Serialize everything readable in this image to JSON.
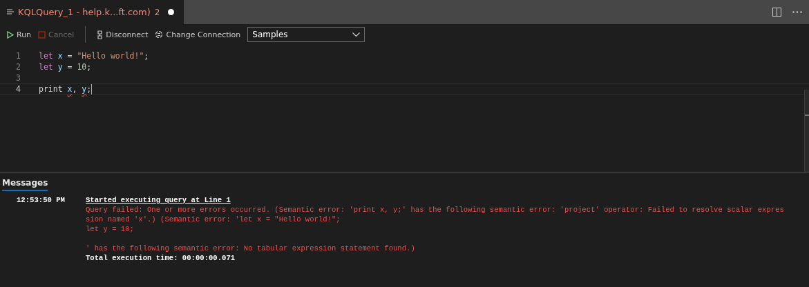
{
  "tab": {
    "title": "KQLQuery_1 - help.k...ft.com)",
    "problems": "2",
    "dirty": true
  },
  "toolbar": {
    "items": [
      {
        "kind": "run",
        "label": "Run",
        "disabled": false
      },
      {
        "kind": "cancel",
        "label": "Cancel",
        "disabled": true
      },
      {
        "kind": "disconnect",
        "label": "Disconnect",
        "disabled": false
      },
      {
        "kind": "connection",
        "label": "Change Connection",
        "disabled": false
      }
    ],
    "database": {
      "value": "Samples"
    }
  },
  "editor": {
    "lines": [
      {
        "number": "1",
        "current": false,
        "tokens": [
          {
            "kind": "keyword",
            "text": "let"
          },
          {
            "kind": "ident",
            "text": " x "
          },
          {
            "kind": "plain",
            "text": "= "
          },
          {
            "kind": "string",
            "text": "\"Hello world!\""
          },
          {
            "kind": "plain",
            "text": ";"
          }
        ]
      },
      {
        "number": "2",
        "current": false,
        "tokens": [
          {
            "kind": "keyword",
            "text": "let"
          },
          {
            "kind": "ident",
            "text": " y "
          },
          {
            "kind": "plain",
            "text": "= "
          },
          {
            "kind": "number",
            "text": "10"
          },
          {
            "kind": "plain",
            "text": ";"
          }
        ]
      },
      {
        "number": "3",
        "current": false
      },
      {
        "number": "4",
        "current": true,
        "tokens": [
          {
            "kind": "plain",
            "text": "print "
          },
          {
            "kind": "error",
            "text": "x"
          },
          {
            "kind": "plain",
            "text": ", "
          },
          {
            "kind": "error",
            "text": "y"
          },
          {
            "kind": "plain",
            "text": ";"
          }
        ]
      }
    ]
  },
  "messages": {
    "tab": {
      "label": "Messages",
      "selected": true
    },
    "entries": [
      {
        "time": "12:53:50 PM",
        "lines": [
          {
            "kind": "header",
            "text": "Started executing query at Line 1"
          },
          {
            "kind": "error",
            "text": "Query failed: One or more errors occurred. (Semantic error: 'print x, y;' has the following semantic error: 'project' operator: Failed to resolve scalar expres"
          },
          {
            "kind": "error",
            "text": "sion named 'x'.) (Semantic error: 'let x = \"Hello world!\";"
          },
          {
            "kind": "error",
            "text": "let y = 10;"
          },
          {
            "kind": "blank"
          },
          {
            "kind": "error",
            "text": "' has the following semantic error: No tabular expression statement found.)"
          },
          {
            "kind": "total",
            "text": "Total execution time: 00:00:00.071"
          }
        ]
      }
    ]
  }
}
